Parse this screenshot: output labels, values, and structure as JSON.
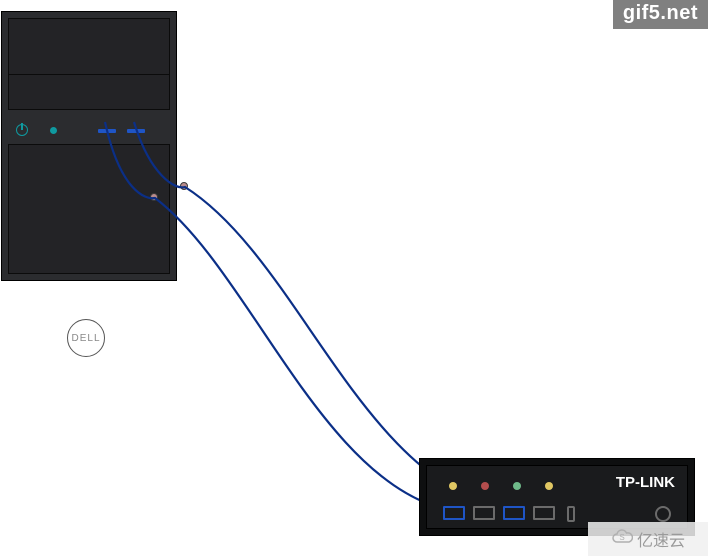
{
  "watermark_top": "gif5.net",
  "watermark_bottom": "亿速云",
  "server": {
    "brand": "DELL"
  },
  "router": {
    "brand": "TP-LINK",
    "leds": [
      {
        "name": "led1",
        "color": "#e0c763"
      },
      {
        "name": "led2",
        "color": "#b34d4d"
      },
      {
        "name": "led3",
        "color": "#6fba8a"
      },
      {
        "name": "led4",
        "color": "#e0c763"
      }
    ],
    "ports": [
      {
        "name": "port1",
        "active": true
      },
      {
        "name": "port2",
        "active": false
      },
      {
        "name": "port3",
        "active": true
      },
      {
        "name": "port4",
        "active": false
      }
    ]
  },
  "cables": {
    "color": "#0b2f87",
    "cable_a": {
      "from": "server-usb1",
      "to": "router-port1"
    },
    "cable_b": {
      "from": "server-usb2",
      "to": "router-port3"
    }
  }
}
